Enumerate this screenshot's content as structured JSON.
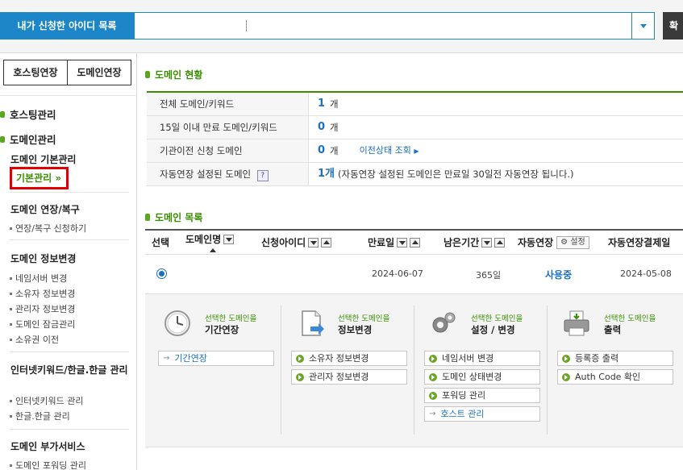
{
  "topbar": {
    "id_list_label": "내가 신청한 아이디 목록",
    "confirm_label": "확"
  },
  "sidebar": {
    "tabs": [
      "호스팅연장",
      "도메인연장"
    ],
    "categories": [
      "호스팅관리",
      "도메인관리"
    ],
    "groups": {
      "basic": "도메인 기본관리",
      "basic_item": "기본관리",
      "renew": "도메인 연장/복구",
      "renew_items": [
        "연장/복구 신청하기"
      ],
      "info": "도메인 정보변경",
      "info_items": [
        "네임서버 변경",
        "소유자 정보변경",
        "관리자 정보변경",
        "도메인 잠금관리",
        "소유권 이전"
      ],
      "keyword": "인터넷키워드/한글.한글 관리",
      "keyword_items": [
        "인터넷키워드 관리",
        "한글.한글 관리"
      ],
      "extra": "도메인 부가서비스",
      "extra_items": [
        "도메인 포워딩 관리"
      ]
    }
  },
  "status": {
    "title": "도메인 현황",
    "rows": [
      {
        "label": "전체 도메인/키워드",
        "num": "1",
        "unit": "개"
      },
      {
        "label": "15일 이내 만료 도메인/키워드",
        "num": "0",
        "unit": "개"
      },
      {
        "label": "기관이전 신청 도메인",
        "num": "0",
        "unit": "개",
        "link": "이전상태 조회"
      },
      {
        "label": "자동연장 설정된 도메인",
        "num": "1개",
        "unit": "(자동연장 설정된 도메인은 만료일 30일전 자동연장 됩니다.)"
      }
    ],
    "help_icon": "?"
  },
  "list": {
    "title": "도메인 목록",
    "headers": {
      "select": "선택",
      "domain": "도메인명",
      "applicant": "신청아이디",
      "expiry": "만료일",
      "remaining": "남은기간",
      "auto": "자동연장",
      "setting": "설정",
      "auto_pay": "자동연장결제일"
    },
    "rows": [
      {
        "expiry": "2024-06-07",
        "remaining": "365일",
        "auto": "사용중",
        "auto_pay": "2024-05-08"
      }
    ]
  },
  "actions": [
    {
      "small": "선택한 도메인을",
      "big": "기간연장",
      "buttons": [
        "기간연장"
      ]
    },
    {
      "small": "선택한 도메인을",
      "big": "정보변경",
      "buttons": [
        "소유자 정보변경",
        "관리자 정보변경"
      ]
    },
    {
      "small": "선택한 도메인을",
      "big": "설정 / 변경",
      "buttons": [
        "네임서버 변경",
        "도메인 상태변경",
        "포워딩 관리",
        "호스트 관리"
      ]
    },
    {
      "small": "선택한 도메인을",
      "big": "출력",
      "buttons": [
        "등록증 출력",
        "Auth Code 확인"
      ]
    }
  ]
}
